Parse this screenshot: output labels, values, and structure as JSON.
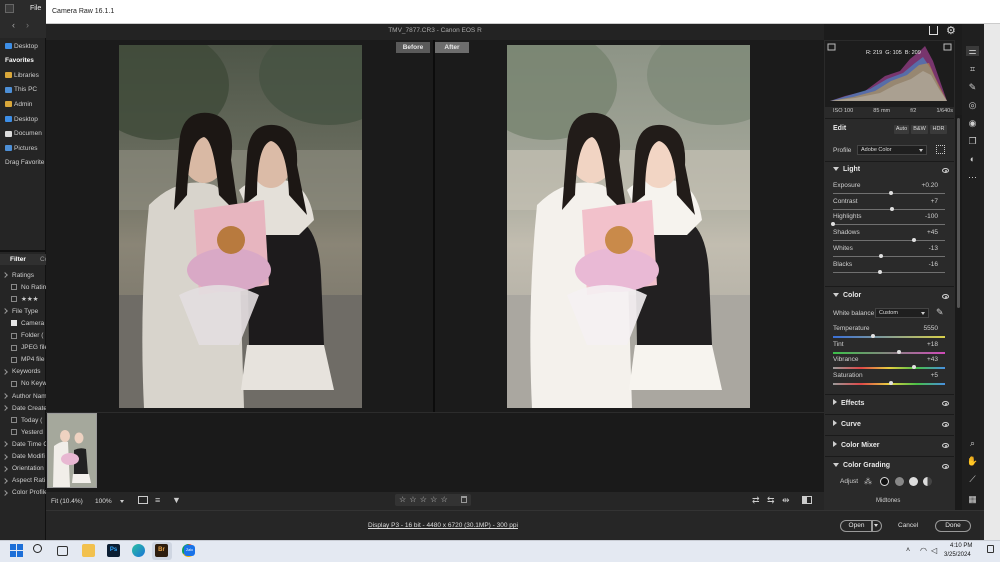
{
  "bridge": {
    "menu_file": "File",
    "nav": [
      {
        "label": "Desktop",
        "bold": false
      },
      {
        "label": "Favorites",
        "bold": true
      },
      {
        "label": "Libraries",
        "bold": false
      },
      {
        "label": "This PC",
        "bold": false
      },
      {
        "label": "Admin",
        "bold": false
      },
      {
        "label": "Desktop",
        "bold": false
      },
      {
        "label": "Documen",
        "bold": false
      },
      {
        "label": "Pictures",
        "bold": false
      },
      {
        "label": "Drag Favorite",
        "bold": false
      }
    ],
    "filter_tabs": [
      "Filter",
      "Co"
    ],
    "filter_items": [
      {
        "label": "Ratings",
        "type": "group"
      },
      {
        "label": "No Rating",
        "type": "check",
        "checked": false
      },
      {
        "label": "★★★",
        "type": "check",
        "checked": false
      },
      {
        "label": "File Type",
        "type": "group"
      },
      {
        "label": "Camera",
        "type": "check",
        "checked": true
      },
      {
        "label": "Folder (",
        "type": "check",
        "checked": false
      },
      {
        "label": "JPEG file",
        "type": "check",
        "checked": false
      },
      {
        "label": "MP4 file",
        "type": "check",
        "checked": false
      },
      {
        "label": "Keywords",
        "type": "group"
      },
      {
        "label": "No Keyw",
        "type": "check",
        "checked": false
      },
      {
        "label": "Author Nam",
        "type": "group"
      },
      {
        "label": "Date Create",
        "type": "group"
      },
      {
        "label": "Today (",
        "type": "check",
        "checked": false
      },
      {
        "label": "Yesterd",
        "type": "check",
        "checked": false
      },
      {
        "label": "Date Time O",
        "type": "group"
      },
      {
        "label": "Date Modifi",
        "type": "group"
      },
      {
        "label": "Orientation",
        "type": "group"
      },
      {
        "label": "Aspect Rati",
        "type": "group"
      },
      {
        "label": "Color Profile",
        "type": "group"
      }
    ]
  },
  "window": {
    "title": "Camera Raw 16.1.1"
  },
  "file_title": "TMV_7877.CR3  -  Canon EOS R",
  "compare": {
    "before": "Before",
    "after": "After"
  },
  "histogram": {
    "r": "R: 219",
    "g": "G: 105",
    "b": "B: 209"
  },
  "camera_info": {
    "iso": "ISO 100",
    "focal": "85 mm",
    "aperture": "f/2",
    "shutter": "1/640s"
  },
  "edit": {
    "title": "Edit",
    "auto": "Auto",
    "bw": "B&W",
    "hdr": "HDR",
    "profile_label": "Profile",
    "profile_value": "Adobe Color"
  },
  "light": {
    "title": "Light",
    "sliders": [
      {
        "label": "Exposure",
        "value": "+0.20",
        "pos": 0.52
      },
      {
        "label": "Contrast",
        "value": "+7",
        "pos": 0.53
      },
      {
        "label": "Highlights",
        "value": "-100",
        "pos": 0.0
      },
      {
        "label": "Shadows",
        "value": "+45",
        "pos": 0.72
      },
      {
        "label": "Whites",
        "value": "-13",
        "pos": 0.43
      },
      {
        "label": "Blacks",
        "value": "-16",
        "pos": 0.42
      }
    ]
  },
  "color": {
    "title": "Color",
    "wb_label": "White balance",
    "wb_value": "Custom",
    "sliders": [
      {
        "label": "Temperature",
        "value": "5550",
        "pos": 0.36,
        "grad": "temp"
      },
      {
        "label": "Tint",
        "value": "+18",
        "pos": 0.59,
        "grad": "tint"
      },
      {
        "label": "Vibrance",
        "value": "+43",
        "pos": 0.72,
        "grad": "sat"
      },
      {
        "label": "Saturation",
        "value": "+5",
        "pos": 0.52,
        "grad": "sat"
      }
    ]
  },
  "panels": {
    "effects": "Effects",
    "curve": "Curve",
    "color_mixer": "Color Mixer",
    "color_grading": "Color Grading",
    "adjust": "Adjust",
    "midtones": "Midtones"
  },
  "bottom": {
    "fit": "Fit (10.4%)",
    "zoom": "100%",
    "stars": "☆ ☆ ☆ ☆ ☆"
  },
  "footer": {
    "info": "Display P3 - 16 bit - 4480 x 6720 (30.1MP) - 300 ppi",
    "open": "Open",
    "cancel": "Cancel",
    "done": "Done"
  },
  "taskbar": {
    "time": "4:10 PM",
    "date": "3/25/2024",
    "ps": "Ps",
    "br": "Br",
    "zalo": "Zalo"
  },
  "colors": {
    "accent": "#4a9ee8",
    "panel": "#2a2a2a",
    "canvas": "#1b1b1b"
  }
}
